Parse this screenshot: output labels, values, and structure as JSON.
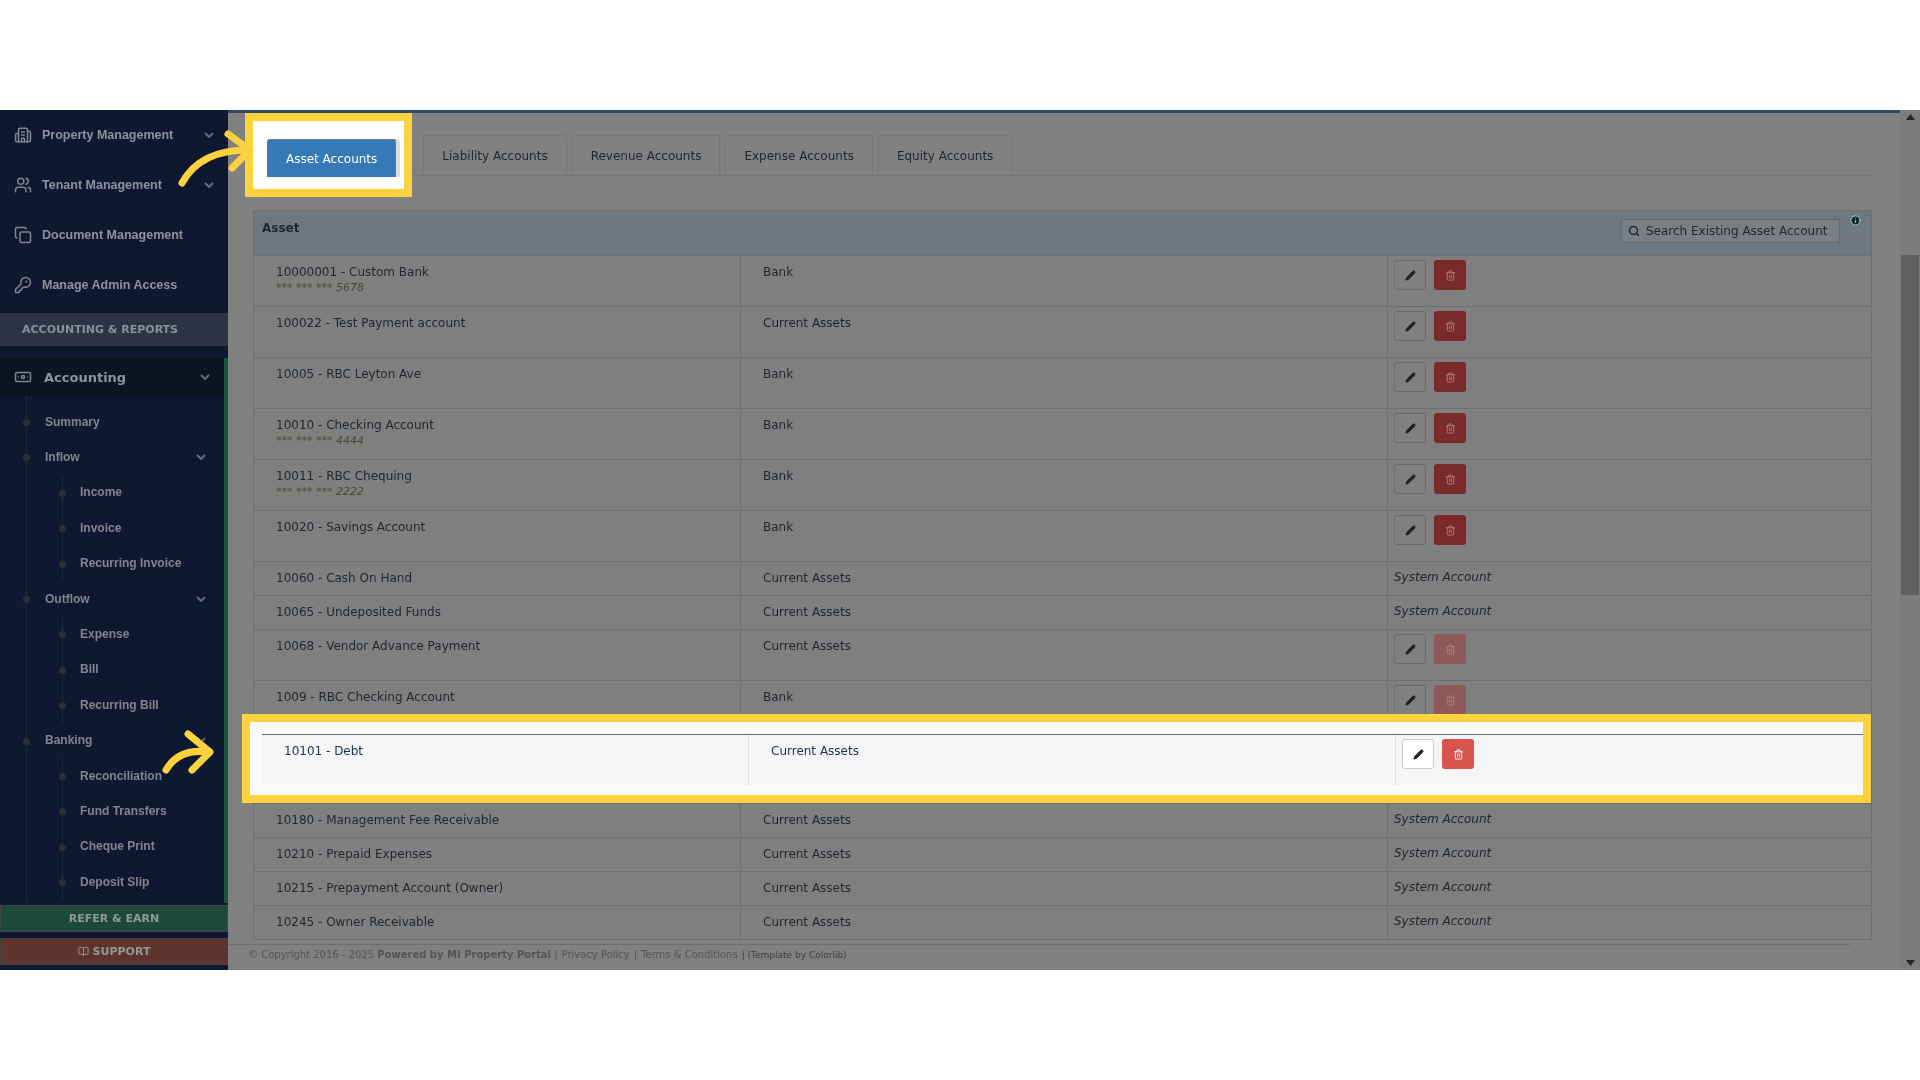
{
  "sidebar": {
    "top_items": [
      {
        "label": "Property Management",
        "expandable": true
      },
      {
        "label": "Tenant Management",
        "expandable": true
      },
      {
        "label": "Document Management",
        "expandable": false
      },
      {
        "label": "Manage Admin Access",
        "expandable": false
      }
    ],
    "section_title": "ACCOUNTING & REPORTS",
    "accounting": {
      "label": "Accounting",
      "expanded": true,
      "children": [
        {
          "label": "Summary"
        },
        {
          "label": "Inflow",
          "expanded": true,
          "children": [
            {
              "label": "Income"
            },
            {
              "label": "Invoice"
            },
            {
              "label": "Recurring Invoice"
            }
          ]
        },
        {
          "label": "Outflow",
          "expanded": true,
          "children": [
            {
              "label": "Expense"
            },
            {
              "label": "Bill"
            },
            {
              "label": "Recurring Bill"
            }
          ]
        },
        {
          "label": "Banking",
          "expanded": true,
          "children": [
            {
              "label": "Reconciliation"
            },
            {
              "label": "Fund Transfers"
            },
            {
              "label": "Cheque Print"
            },
            {
              "label": "Deposit Slip"
            }
          ]
        }
      ]
    },
    "refer_button": "REFER & EARN",
    "support_button": "SUPPORT"
  },
  "tabs": [
    {
      "label": "Asset Accounts",
      "selected": true,
      "highlighted": true
    },
    {
      "label": "Liability Accounts",
      "selected": false,
      "highlighted": false
    },
    {
      "label": "Revenue Accounts",
      "selected": false,
      "highlighted": false
    },
    {
      "label": "Expense Accounts",
      "selected": false,
      "highlighted": false
    },
    {
      "label": "Equity Accounts",
      "selected": false,
      "highlighted": false
    }
  ],
  "table": {
    "header": "Asset",
    "search": {
      "placeholder": "Search Existing Asset Account"
    },
    "rows": [
      {
        "name": "10000001 - Custom Bank",
        "mask": "*** *** *** 5678",
        "type": "Bank",
        "kind": "buttons",
        "delete_disabled": false,
        "highlighted": false
      },
      {
        "name": "100022 - Test Payment account",
        "type": "Current Assets",
        "kind": "buttons",
        "delete_disabled": false,
        "highlighted": false
      },
      {
        "name": "10005 - RBC Leyton Ave",
        "type": "Bank",
        "kind": "buttons",
        "delete_disabled": false,
        "highlighted": false
      },
      {
        "name": "10010 - Checking Account",
        "mask": "*** *** *** 4444",
        "type": "Bank",
        "kind": "buttons",
        "delete_disabled": false,
        "highlighted": false
      },
      {
        "name": "10011 - RBC Chequing",
        "mask": "*** *** *** 2222",
        "type": "Bank",
        "kind": "buttons",
        "delete_disabled": false,
        "highlighted": false
      },
      {
        "name": "10020 - Savings Account",
        "type": "Bank",
        "kind": "buttons",
        "delete_disabled": false,
        "highlighted": false
      },
      {
        "name": "10060 - Cash On Hand",
        "type": "Current Assets",
        "kind": "system",
        "note": "System Account",
        "highlighted": false
      },
      {
        "name": "10065 - Undeposited Funds",
        "type": "Current Assets",
        "kind": "system",
        "note": "System Account",
        "highlighted": false
      },
      {
        "name": "10068 - Vendor Advance Payment",
        "type": "Current Assets",
        "kind": "buttons",
        "delete_disabled": true,
        "highlighted": false
      },
      {
        "name": "1009 - RBC Checking Account",
        "type": "Bank",
        "kind": "buttons",
        "delete_disabled": true,
        "highlighted": false
      },
      {
        "name": "10101 - Debt",
        "type": "Current Assets",
        "kind": "buttons",
        "delete_disabled": false,
        "highlighted": true
      },
      {
        "name": "10180 - Management Fee Receivable",
        "type": "Current Assets",
        "kind": "system",
        "note": "System Account",
        "highlighted": false
      },
      {
        "name": "10210 - Prepaid Expenses",
        "type": "Current Assets",
        "kind": "system",
        "note": "System Account",
        "highlighted": false
      },
      {
        "name": "10215 - Prepayment Account (Owner)",
        "type": "Current Assets",
        "kind": "system",
        "note": "System Account",
        "highlighted": false
      },
      {
        "name": "10245 - Owner Receivable",
        "type": "Current Assets",
        "kind": "system",
        "note": "System Account",
        "highlighted": false
      }
    ]
  },
  "footer": {
    "copyright": "© Copyright 2016 - 2025 **Powered by MI Property Portal** |",
    "links": [
      "Privacy Policy",
      "|",
      "Terms & Conditions"
    ],
    "credit": "| (Template by Colorlib)"
  }
}
